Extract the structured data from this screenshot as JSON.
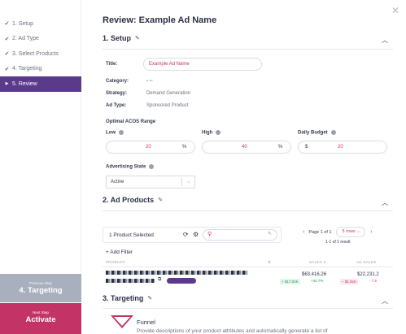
{
  "window": {
    "close_symbol": "✕"
  },
  "sidebar": {
    "steps": [
      {
        "label": "1. Setup",
        "done": true
      },
      {
        "label": "2. Ad Type",
        "done": true
      },
      {
        "label": "3. Select Products",
        "done": true
      },
      {
        "label": "4. Targeting",
        "done": true
      },
      {
        "label": "5. Review",
        "active": true
      }
    ],
    "previous": {
      "small": "Previous Step",
      "label": "4. Targeting"
    },
    "next": {
      "small": "Next Step",
      "label": "Activate"
    }
  },
  "page": {
    "title": "Review: Example Ad Name"
  },
  "setup": {
    "heading": "1. Setup",
    "title_label": "Title:",
    "title_value": "Example Ad Name",
    "category_label": "Category:",
    "strategy_label": "Strategy:",
    "strategy_value": "Demand Generation",
    "adtype_label": "Ad Type:",
    "adtype_value": "Sponsored Product",
    "acos_heading": "Optimal ACOS Range",
    "low_label": "Low",
    "low_value": "20",
    "low_unit": "%",
    "high_label": "High",
    "high_value": "40",
    "high_unit": "%",
    "budget_label": "Daily Budget",
    "budget_prefix": "$",
    "budget_value": "20",
    "state_label": "Advertising State",
    "state_value": "Active"
  },
  "products": {
    "heading": "2. Ad Products",
    "count_label": "1 Product Selected",
    "page_text": "Page 1 of 1",
    "rows_label": "5 rows",
    "result_text": "1-1 of 1 result",
    "add_filter": "+ Add Filter",
    "columns": {
      "product": "PRODUCT",
      "sales": "SALES",
      "ad_sales": "AD SALES"
    },
    "row": {
      "sales": "$63,416.26",
      "sales_delta": "+ $17.04K",
      "sales_pct": "+34.7%",
      "ad_sales": "$22,231.2",
      "ad_sales_delta": "− $1.81K",
      "ad_sales_pct": "- 7.5"
    }
  },
  "targeting": {
    "heading": "3. Targeting",
    "funnel_label": "Funnel",
    "funnel_desc": "Provide descriptions of your product attributes and automatically generate a list of"
  },
  "colors": {
    "accent": "#c43366",
    "active_step": "#5b3a8c",
    "prev_button": "#a8b0bd"
  },
  "icons": [
    "check-icon",
    "chevron-right-icon",
    "pencil-icon",
    "chevron-up-icon",
    "info-icon",
    "refresh-icon",
    "gear-icon",
    "search-icon",
    "chevron-left-icon",
    "external-link-icon",
    "sort-icon",
    "funnel-icon",
    "close-icon"
  ]
}
